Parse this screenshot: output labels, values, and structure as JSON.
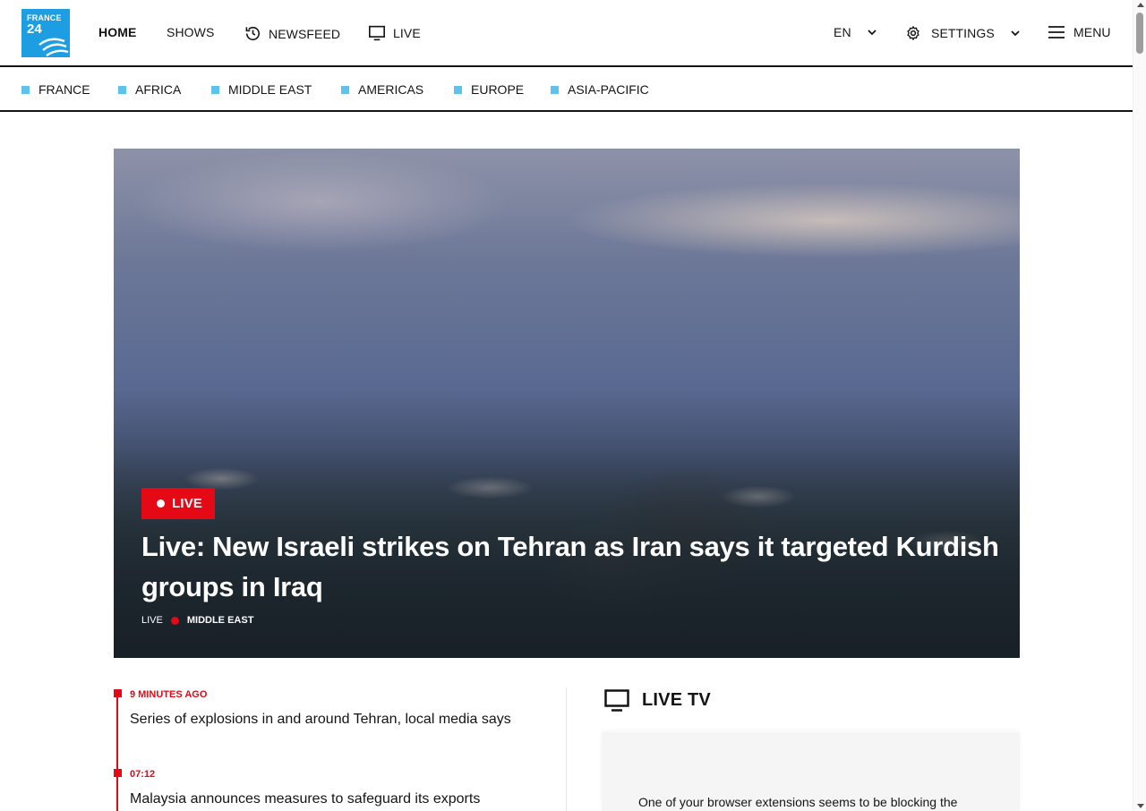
{
  "logo": {
    "line1": "FRANCE",
    "line2": "24"
  },
  "nav": {
    "home": "HOME",
    "shows": "SHOWS",
    "newsfeed": "NEWSFEED",
    "live": "LIVE",
    "language": "EN",
    "settings": "SETTINGS",
    "menu": "MENU"
  },
  "regions": [
    "FRANCE",
    "AFRICA",
    "MIDDLE EAST",
    "AMERICAS",
    "EUROPE",
    "ASIA-PACIFIC"
  ],
  "hero": {
    "badge": "LIVE",
    "title": "Live: New Israeli strikes on Tehran as Iran says it targeted Kurdish groups in Iraq",
    "meta_label": "LIVE",
    "meta_category": "MIDDLE EAST"
  },
  "feed": [
    {
      "time": "9 MINUTES AGO",
      "headline": "Series of explosions in and around Tehran, local media says"
    },
    {
      "time": "07:12",
      "headline": "Malaysia announces measures to safeguard its exports"
    }
  ],
  "live_tv": {
    "title": "LIVE TV",
    "message": "One of your browser extensions seems to be blocking the"
  },
  "colors": {
    "accent_red": "#e50815",
    "logo_blue": "#1d9ee2",
    "region_marker": "#5dc2ec"
  }
}
